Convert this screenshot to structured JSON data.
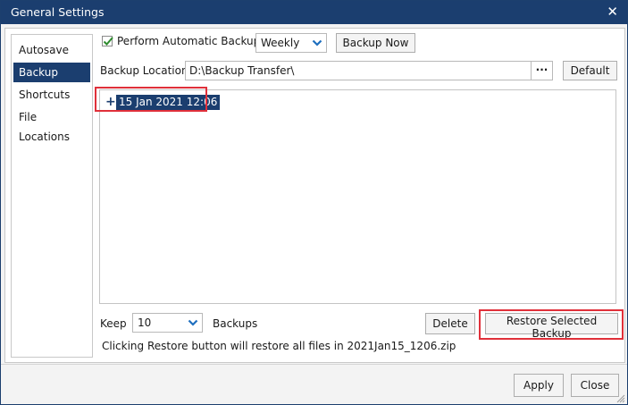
{
  "window": {
    "title": "General Settings",
    "close_glyph": "✕"
  },
  "sidebar": {
    "items": [
      {
        "label": "Autosave"
      },
      {
        "label": "Backup"
      },
      {
        "label": "Shortcuts"
      },
      {
        "label": "File Locations"
      }
    ],
    "selected": "Backup"
  },
  "backup": {
    "auto_backup_label": "Perform Automatic Backups",
    "auto_backup_checked": true,
    "frequency": "Weekly",
    "backup_now_label": "Backup Now",
    "location_label": "Backup Location",
    "location_value": "D:\\Backup Transfer\\",
    "browse_label": "···",
    "default_label": "Default",
    "tree": {
      "expand_glyph": "+",
      "items": [
        "15 Jan 2021 12:06"
      ]
    },
    "keep_label": "Keep",
    "keep_value": "10",
    "backups_label": "Backups",
    "delete_label": "Delete",
    "restore_label": "Restore Selected Backup",
    "info_text": "Clicking Restore button will restore all files in 2021Jan15_1206.zip"
  },
  "footer": {
    "apply_label": "Apply",
    "close_label": "Close"
  },
  "colors": {
    "titlebar": "#1b3e6f",
    "selection": "#1b3e6f",
    "highlight": "#e0303a",
    "check": "#2e8b2e"
  }
}
